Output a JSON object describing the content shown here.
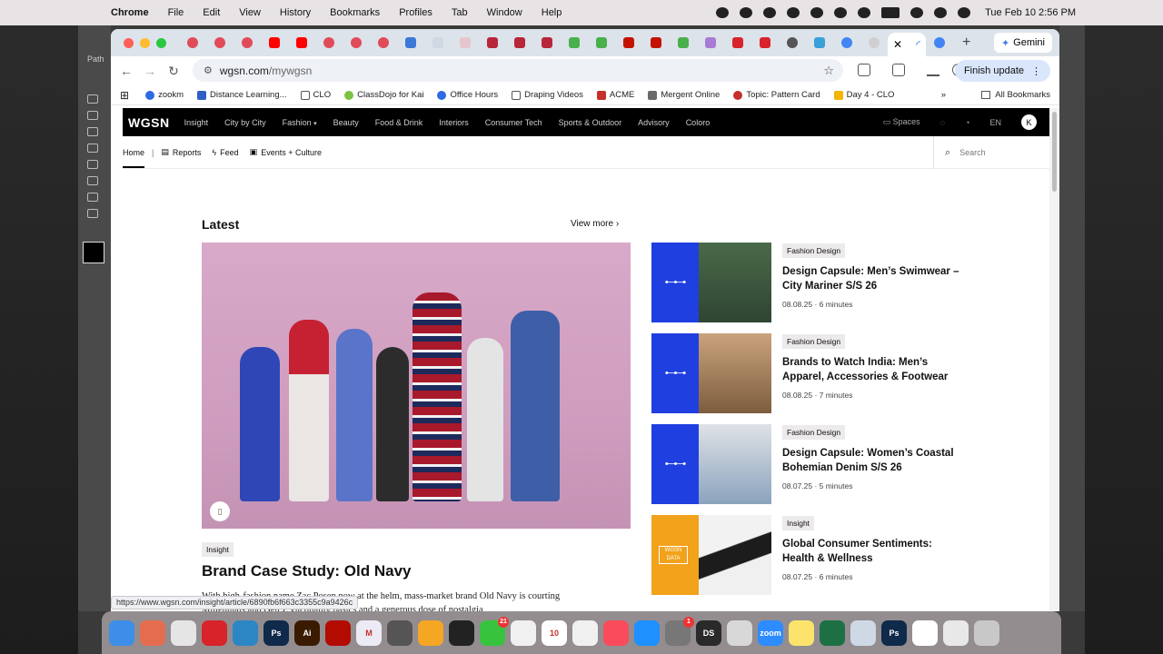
{
  "menubar": {
    "app": "Chrome",
    "items": [
      "File",
      "Edit",
      "View",
      "History",
      "Bookmarks",
      "Profiles",
      "Tab",
      "Window",
      "Help"
    ],
    "clock": "Tue Feb 10  2:56 PM"
  },
  "photoshop": {
    "panel_title": "Path"
  },
  "browser": {
    "active_tab_icon": "loading-icon",
    "new_tab": "+",
    "gemini": "Gemini",
    "url_domain": "wgsn.com",
    "url_path": "/mywgsn",
    "finish_update": "Finish update",
    "bookmarks": [
      {
        "label": "zookm",
        "color": "#2d6ae3"
      },
      {
        "label": "Distance Learning...",
        "color": "#2f5fc4"
      },
      {
        "label": "CLO",
        "color": "#555555"
      },
      {
        "label": "ClassDojo for Kai",
        "color": "#7cc242"
      },
      {
        "label": "Office Hours",
        "color": "#2d6ae3"
      },
      {
        "label": "Draping Videos",
        "color": "#555555"
      },
      {
        "label": "ACME",
        "color": "#c4302b"
      },
      {
        "label": "Mergent Online",
        "color": "#6a6a6a"
      },
      {
        "label": "Topic: Pattern Card",
        "color": "#c4302b"
      },
      {
        "label": "Day 4 - CLO",
        "color": "#f4b400"
      }
    ],
    "all_bookmarks": "All Bookmarks",
    "status_url": "https://www.wgsn.com/insight/article/6890fb6f663c3355c9a9426c"
  },
  "wgsn": {
    "logo": "WGSN",
    "nav": [
      "Insight",
      "City by City",
      "Fashion",
      "Beauty",
      "Food & Drink",
      "Interiors",
      "Consumer Tech",
      "Sports & Outdoor",
      "Advisory",
      "Coloro"
    ],
    "spaces": "Spaces",
    "lang": "EN",
    "avatar": "K",
    "subnav": {
      "home": "Home",
      "sep": "|",
      "reports": "Reports",
      "feed": "Feed",
      "events": "Events + Culture",
      "search_placeholder": "Search"
    },
    "latest": "Latest",
    "view_more": "View more",
    "hero": {
      "tag": "Insight",
      "title": "Brand Case Study: Old Navy",
      "desc": "With high-fashion name Zac Posen now at the helm, mass-market brand Old Navy is courting Millennials and Gen Z via quality basics and a generous dose of nostalgia"
    },
    "cards": [
      {
        "tag": "Fashion Design",
        "title": "Design Capsule: Men’s Swimwear – City Mariner S/S 26",
        "meta": "08.08.25 · 6 minutes"
      },
      {
        "tag": "Fashion Design",
        "title": "Brands to Watch India: Men’s Apparel, Accessories & Footwear",
        "meta": "08.08.25 · 7 minutes"
      },
      {
        "tag": "Fashion Design",
        "title": "Design Capsule: Women’s Coastal Bohemian Denim S/S 26",
        "meta": "08.07.25 · 5 minutes"
      },
      {
        "tag": "Insight",
        "title": "Global Consumer Sentiments: Health & Wellness",
        "meta": "08.07.25 · 6 minutes"
      }
    ],
    "data_badge": "WGSN DATA"
  },
  "dock": {
    "apps": [
      {
        "name": "finder",
        "label": "",
        "color": "#3d8ee8"
      },
      {
        "name": "launchpad",
        "label": "",
        "color": "#e46d4f"
      },
      {
        "name": "chrome",
        "label": "",
        "color": "#e5e5e5"
      },
      {
        "name": "acrobat-pro",
        "label": "",
        "color": "#d8232a"
      },
      {
        "name": "clo",
        "label": "",
        "color": "#2d86c4"
      },
      {
        "name": "photoshop",
        "label": "Ps",
        "color": "#0f2a4a"
      },
      {
        "name": "illustrator",
        "label": "Ai",
        "color": "#3a1b00"
      },
      {
        "name": "acrobat",
        "label": "",
        "color": "#b30b00"
      },
      {
        "name": "mendeley",
        "label": "M",
        "color": "#eceaf5"
      },
      {
        "name": "screenshot",
        "label": "",
        "color": "#555555"
      },
      {
        "name": "pages",
        "label": "",
        "color": "#f5a623"
      },
      {
        "name": "obs",
        "label": "",
        "color": "#222222"
      },
      {
        "name": "messages",
        "label": "",
        "color": "#38c33f",
        "badge": "21"
      },
      {
        "name": "photos",
        "label": "",
        "color": "#f0f0f0"
      },
      {
        "name": "calendar",
        "label": "10",
        "color": "#ffffff"
      },
      {
        "name": "freeform",
        "label": "",
        "color": "#f0f0f0"
      },
      {
        "name": "music",
        "label": "",
        "color": "#f94b5b"
      },
      {
        "name": "app-store",
        "label": "",
        "color": "#1e90ff"
      },
      {
        "name": "system-settings",
        "label": "",
        "color": "#777777",
        "badge": "1"
      },
      {
        "name": "ds",
        "label": "DS",
        "color": "#2a2a2a"
      },
      {
        "name": "acrobat-reader",
        "label": "",
        "color": "#d8d8d8"
      },
      {
        "name": "zoom",
        "label": "zoom",
        "color": "#2d8cff"
      },
      {
        "name": "notes",
        "label": "",
        "color": "#fbe36c"
      },
      {
        "name": "excel",
        "label": "",
        "color": "#1d7044"
      },
      {
        "name": "preview",
        "label": "",
        "color": "#cfd9e6"
      },
      {
        "name": "photoshop-2",
        "label": "Ps",
        "color": "#0f2a4a"
      },
      {
        "name": "printer",
        "label": "",
        "color": "#ffffff"
      },
      {
        "name": "downloads",
        "label": "",
        "color": "#e8e8e8"
      },
      {
        "name": "trash",
        "label": "",
        "color": "#c8c8c8"
      }
    ]
  }
}
